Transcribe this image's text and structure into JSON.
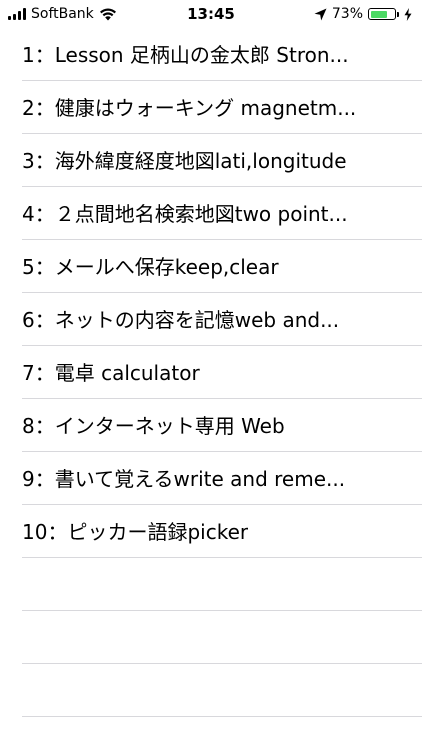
{
  "status_bar": {
    "carrier": "SoftBank",
    "time": "13:45",
    "battery_percent": "73%",
    "battery_level": 0.73,
    "battery_color": "#4cd964",
    "icons": [
      "signal-bars-icon",
      "wifi-icon",
      "location-arrow-icon",
      "battery-icon",
      "charging-bolt-icon"
    ]
  },
  "list": {
    "items": [
      {
        "label": "1：Lesson 足柄山の金太郎 Stron..."
      },
      {
        "label": "2：健康はウォーキング magnetm..."
      },
      {
        "label": "3：海外緯度経度地図lati,longitude"
      },
      {
        "label": "4：２点間地名検索地図two point..."
      },
      {
        "label": "5：メールへ保存keep,clear"
      },
      {
        "label": "6：ネットの内容を記憶web and..."
      },
      {
        "label": "7：電卓 calculator"
      },
      {
        "label": "8：インターネット専用 Web"
      },
      {
        "label": "9：書いて覚えるwrite and reme..."
      },
      {
        "label": "10：ピッカー語録picker"
      },
      {
        "label": ""
      },
      {
        "label": ""
      },
      {
        "label": ""
      }
    ]
  }
}
